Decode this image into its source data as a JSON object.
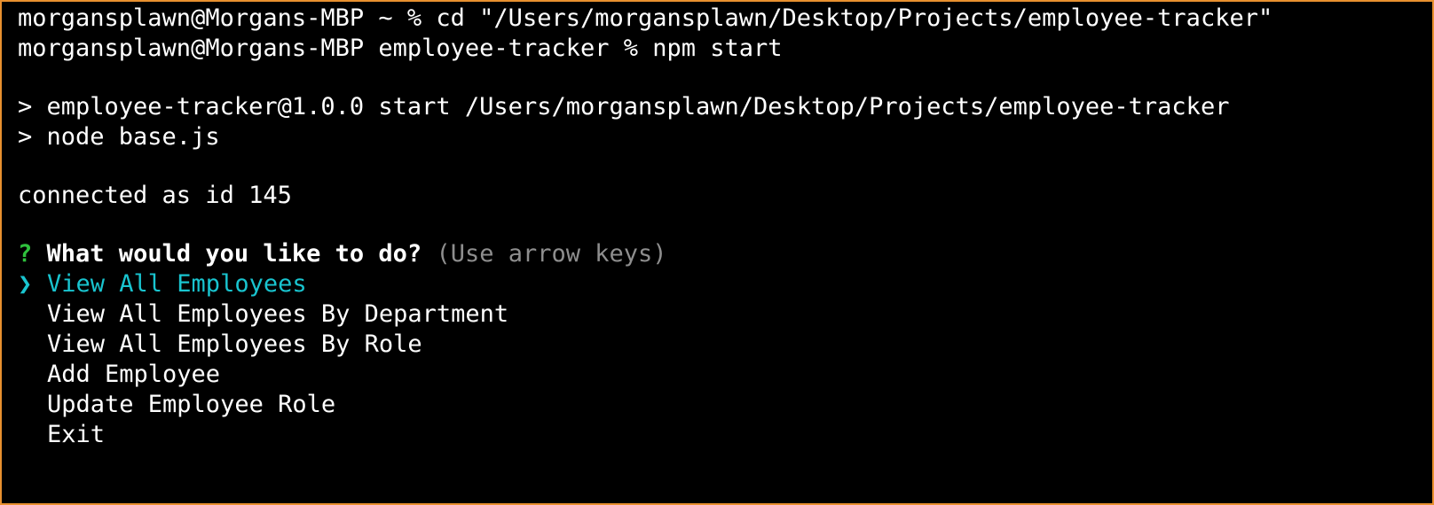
{
  "colors": {
    "window_border": "#e8902f",
    "background": "#000000",
    "text": "#ffffff",
    "prompt_mark": "#2fc13d",
    "highlight": "#19c4cf",
    "hint": "#8e8e8e"
  },
  "history": [
    "morgansplawn@Morgans-MBP ~ % cd \"/Users/morgansplawn/Desktop/Projects/employee-tracker\"",
    "morgansplawn@Morgans-MBP employee-tracker % npm start",
    "",
    "> employee-tracker@1.0.0 start /Users/morgansplawn/Desktop/Projects/employee-tracker",
    "> node base.js",
    "",
    "connected as id 145",
    ""
  ],
  "prompt": {
    "mark": "?",
    "question": "What would you like to do?",
    "hint": "(Use arrow keys)"
  },
  "menu": {
    "pointer": "❯",
    "selected_index": 0,
    "items": [
      "View All Employees",
      "View All Employees By Department",
      "View All Employees By Role",
      "Add Employee",
      "Update Employee Role",
      "Exit"
    ]
  }
}
